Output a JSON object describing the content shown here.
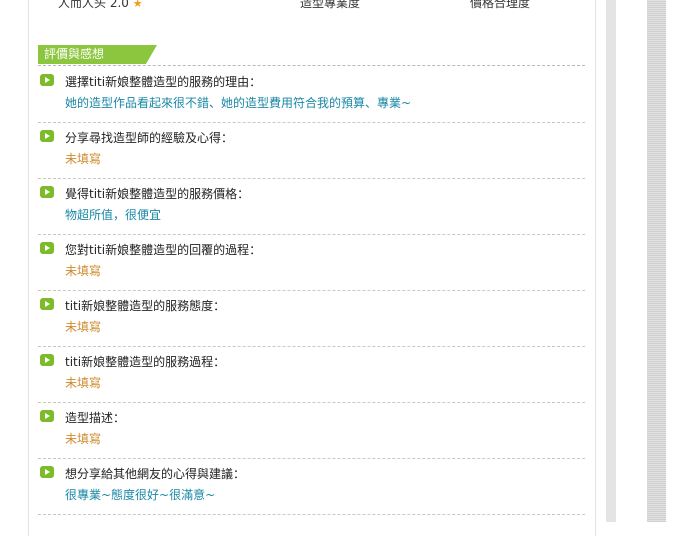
{
  "top": {
    "frag_left": "人而人头",
    "frag_score": "2.0",
    "frag_mid": "造型專業度",
    "frag_right": "價格合理度"
  },
  "section": {
    "title": "評價與感想"
  },
  "items": [
    {
      "question": "選擇titi新娘整體造型的服務的理由：",
      "answer": "她的造型作品看起來很不錯、她的造型費用符合我的預算、專業~",
      "filled": true
    },
    {
      "question": "分享尋找造型師的經驗及心得：",
      "answer": "未填寫",
      "filled": false
    },
    {
      "question": "覺得titi新娘整體造型的服務價格：",
      "answer": "物超所值，很便宜",
      "filled": true
    },
    {
      "question": "您對titi新娘整體造型的回覆的過程：",
      "answer": "未填寫",
      "filled": false
    },
    {
      "question": "titi新娘整體造型的服務態度：",
      "answer": "未填寫",
      "filled": false
    },
    {
      "question": "titi新娘整體造型的服務過程：",
      "answer": "未填寫",
      "filled": false
    },
    {
      "question": "造型描述：",
      "answer": "未填寫",
      "filled": false
    },
    {
      "question": "想分享給其他網友的心得與建議：",
      "answer": "很專業~態度很好~很滿意~",
      "filled": true
    }
  ],
  "colors": {
    "accent": "#8cc63f",
    "answer": "#1a88a6",
    "empty": "#d08a2a"
  }
}
